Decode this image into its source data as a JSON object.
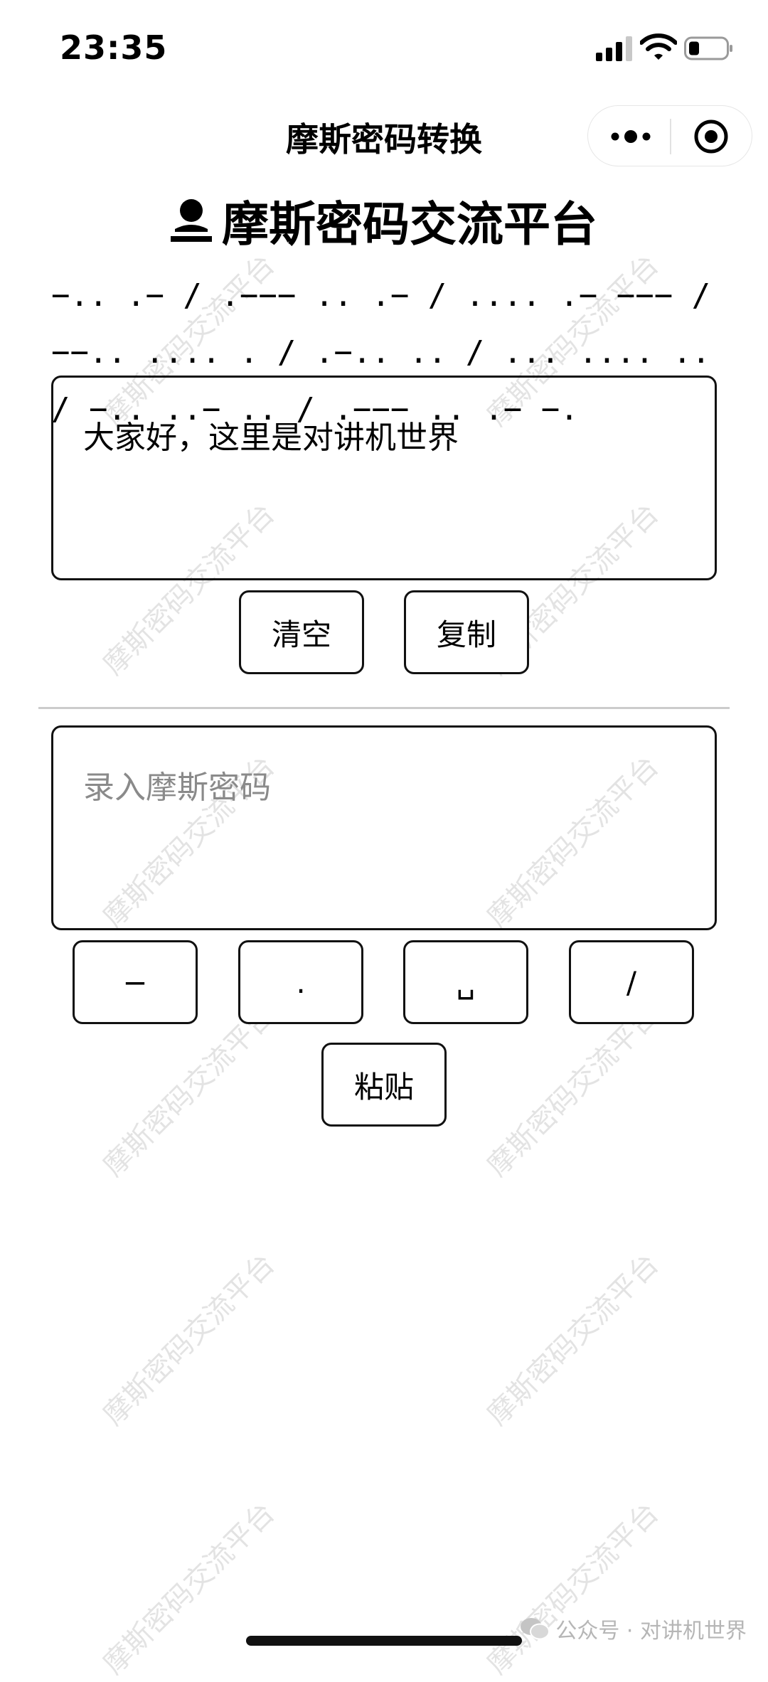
{
  "status_bar": {
    "time": "23:35"
  },
  "nav": {
    "title": "摩斯密码转换"
  },
  "heading": {
    "title": "摩斯密码交流平台"
  },
  "morse_output": "−.. .− / .−−− .. .− / .... .− −−− / −−.. .... . / .−.. .. / ... .... .. / −.. ..− .. / .−−− .. .− −.",
  "text_input": {
    "value": "大家好，这里是对讲机世界"
  },
  "text_actions": {
    "clear_label": "清空",
    "copy_label": "复制"
  },
  "morse_input": {
    "placeholder": "录入摩斯密码"
  },
  "morse_keys": {
    "dash": "−",
    "dot": ".",
    "space": "␣",
    "slash": "/",
    "paste": "粘贴"
  },
  "watermark": {
    "text": "摩斯密码交流平台"
  },
  "footer": {
    "source": "公众号 · 对讲机世界"
  },
  "icons": [
    "signal-icon",
    "wifi-icon",
    "battery-icon",
    "more-icon",
    "target-icon",
    "user-icon",
    "wechat-icon"
  ]
}
